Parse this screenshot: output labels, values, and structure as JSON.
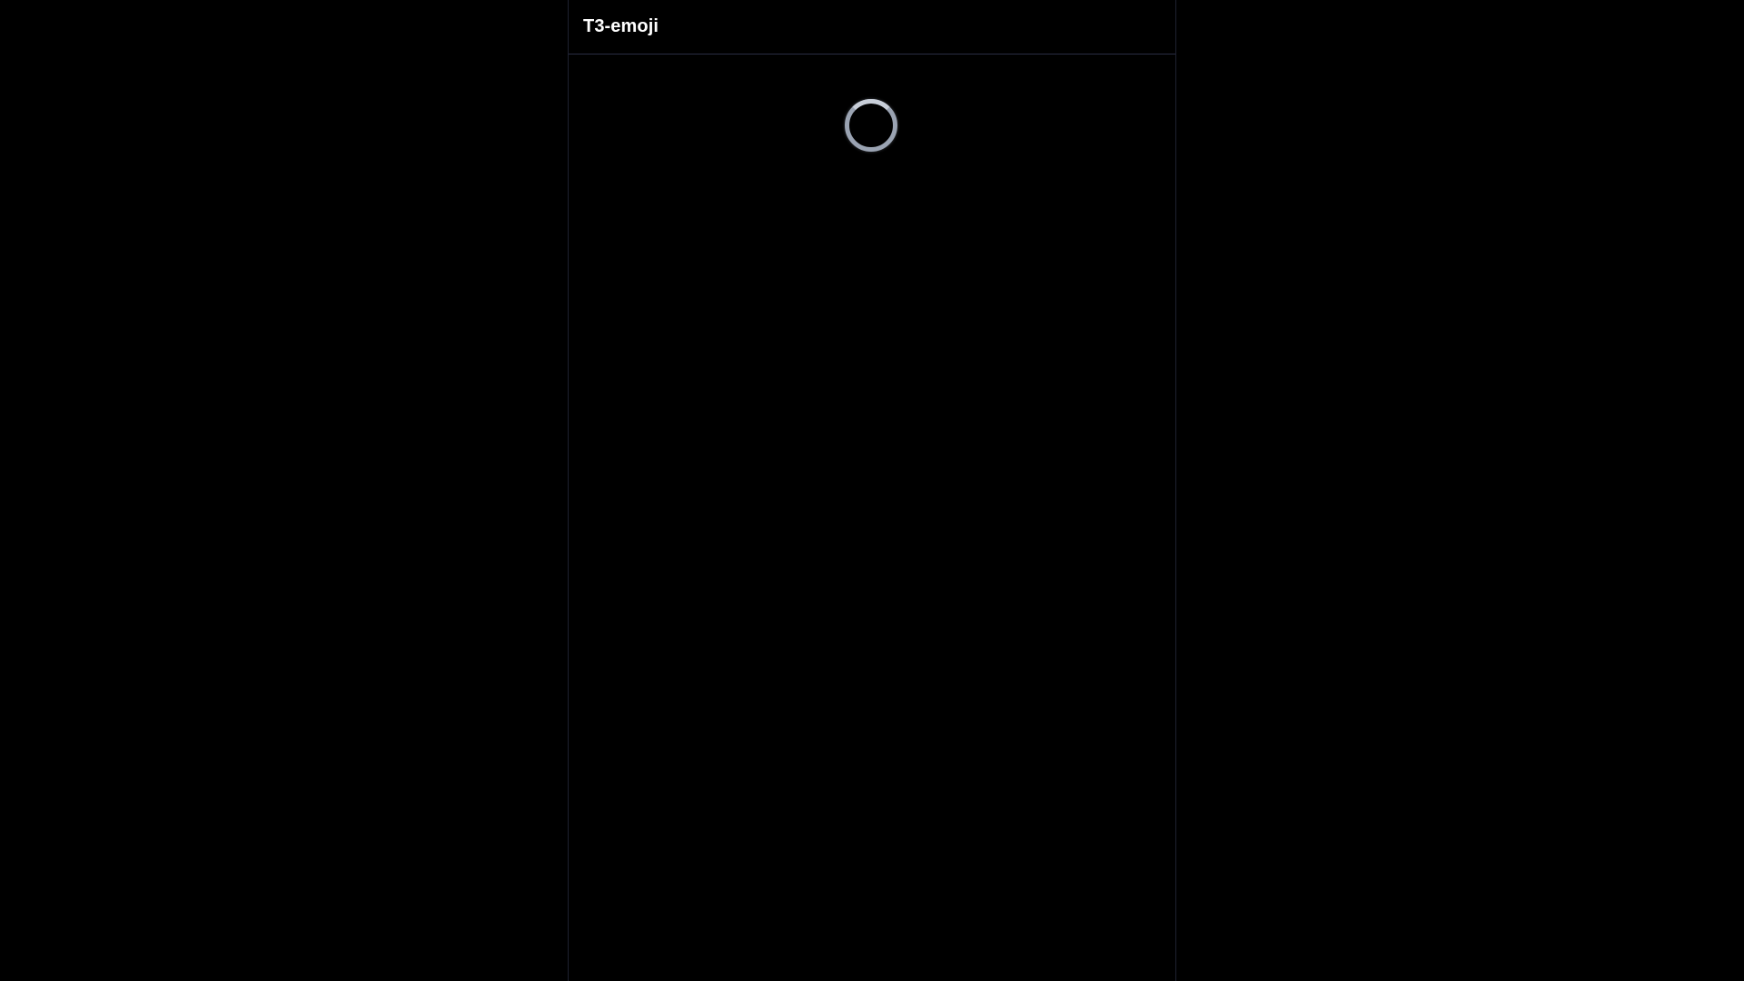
{
  "app": {
    "title": "T3-emoji"
  },
  "feed": {
    "state": "loading",
    "spinner_icon": "loading-spinner-icon"
  },
  "colors": {
    "background": "#000000",
    "border": "#1e2130",
    "header_border": "#2a2d44",
    "title_text": "#ffffff",
    "spinner": "#9aa3b2"
  }
}
